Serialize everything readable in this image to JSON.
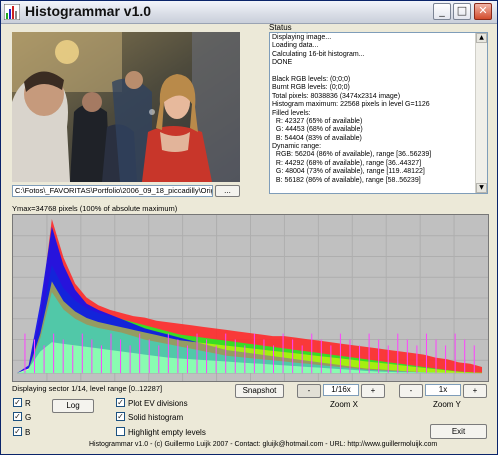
{
  "window": {
    "title": "Histogrammar v1.0",
    "minimize": "_",
    "maximize": "□",
    "close": "✕"
  },
  "image_panel": {
    "file_path": "C:\\Fotos\\_FAVORITAS\\Portfolio\\2006_09_18_piccadilly\\Original\\_M",
    "browse_label": "..."
  },
  "status": {
    "label": "Status",
    "lines": [
      "Displaying image...",
      "Loading data...",
      "Calculating 16-bit histogram...",
      "DONE",
      "",
      "Black RGB levels: (0;0;0)",
      "Burnt RGB levels: (0;0;0)",
      "Total pixels: 8038836 (3474x2314 image)",
      "Histogram maximum: 22568 pixels in level G=1126",
      "Filled levels:",
      "  R: 42327 (65% of available)",
      "  G: 44453 (68% of available)",
      "  B: 54404 (83% of available)",
      "Dynamic range:",
      "  RGB: 56204 (86% of available), range [36..56239]",
      "  R: 44292 (68% of available), range [36..44327]",
      "  G: 48004 (73% of available), range [119..48122]",
      "  B: 56182 (86% of available), range [58..56239]"
    ]
  },
  "histogram": {
    "ymax_label": "Ymax=34768 pixels (100% of absolute maximum)",
    "colors": {
      "background": "#c0c0c0",
      "grid": "#aeaeae",
      "red": "#ff2a2a",
      "green": "#22ee22",
      "blue": "#1010ee",
      "yellow": "#ffff00",
      "cyan": "#00ffff",
      "magenta": "#ff40ff",
      "white": "#ffffff"
    }
  },
  "chart_data": {
    "type": "area",
    "x": [
      0,
      1,
      2,
      3,
      4,
      5,
      6,
      7,
      8,
      9,
      10,
      11,
      12,
      13,
      14,
      15,
      16,
      17,
      18,
      19,
      20,
      21,
      22,
      23,
      24,
      25,
      26,
      27,
      28,
      29,
      30,
      31,
      32,
      33,
      34,
      35,
      36,
      37,
      38,
      39,
      40
    ],
    "grid_divisions_x": 14,
    "grid_divisions_y": 8,
    "ylim": [
      0,
      34768
    ],
    "series": [
      {
        "values": [
          0,
          1390,
          13212,
          34768,
          26075,
          20164,
          17035,
          15297,
          14254,
          13559,
          12864,
          12517,
          11822,
          11474,
          11127,
          10779,
          10431,
          10084,
          9736,
          9388,
          9040,
          8693,
          8345,
          8345,
          7997,
          7650,
          7302,
          6954,
          6606,
          6259,
          5911,
          5563,
          5216,
          4868,
          4520,
          4172,
          3477,
          3129,
          2434,
          2086,
          1391
        ]
      },
      {
        "values": [
          0,
          1043,
          10431,
          24337,
          19125,
          16340,
          14602,
          13559,
          12864,
          12169,
          11474,
          10779,
          10084,
          9388,
          8693,
          8345,
          7997,
          7650,
          7302,
          6954,
          6606,
          6259,
          5911,
          5563,
          5216,
          4868,
          4520,
          4172,
          3825,
          3477,
          3129,
          2782,
          2434,
          2086,
          1738,
          1391,
          1043,
          695,
          348,
          174,
          70
        ]
      },
      {
        "values": [
          0,
          1738,
          15646,
          33030,
          24337,
          18774,
          15646,
          14254,
          13212,
          12169,
          11127,
          10084,
          9388,
          8693,
          7997,
          7302,
          6606,
          5911,
          5216,
          4868,
          4520,
          4172,
          3825,
          3477,
          3129,
          2782,
          2434,
          2086,
          1738,
          1391,
          1043,
          869,
          695,
          522,
          348,
          209,
          139,
          70,
          35,
          17,
          0
        ]
      },
      {
        "values": [
          0,
          1043,
          4868,
          6954,
          6606,
          6259,
          5911,
          5563,
          5216,
          4868,
          4520,
          4172,
          3825,
          3477,
          3303,
          3129,
          2956,
          2782,
          2608,
          2434,
          2260,
          2086,
          1912,
          1738,
          1565,
          1391,
          1217,
          1043,
          869,
          695,
          522,
          348,
          278,
          209,
          174,
          139,
          104,
          70,
          35,
          17,
          0
        ]
      }
    ]
  },
  "controls": {
    "sector_label": "Displaying sector 1/14, level range [0..12287]",
    "chk_r": "R",
    "chk_g": "G",
    "chk_b": "B",
    "log_label": "Log",
    "plot_ev": "Plot EV divisions",
    "solid": "Solid histogram",
    "highlight_empty": "Highlight empty levels",
    "snapshot_label": "Snapshot",
    "zoomx_minus": "-",
    "zoomx_value": "1/16x",
    "zoomx_plus": "+",
    "zoomx_label": "Zoom X",
    "zoomy_minus": "-",
    "zoomy_value": "1x",
    "zoomy_plus": "+",
    "zoomy_label": "Zoom Y",
    "exit_label": "Exit",
    "footer": "Histogrammar v1.0 - (c) Guillermo Luijk 2007 - Contact: gluijk@hotmail.com - URL: http://www.guillermoluijk.com"
  }
}
